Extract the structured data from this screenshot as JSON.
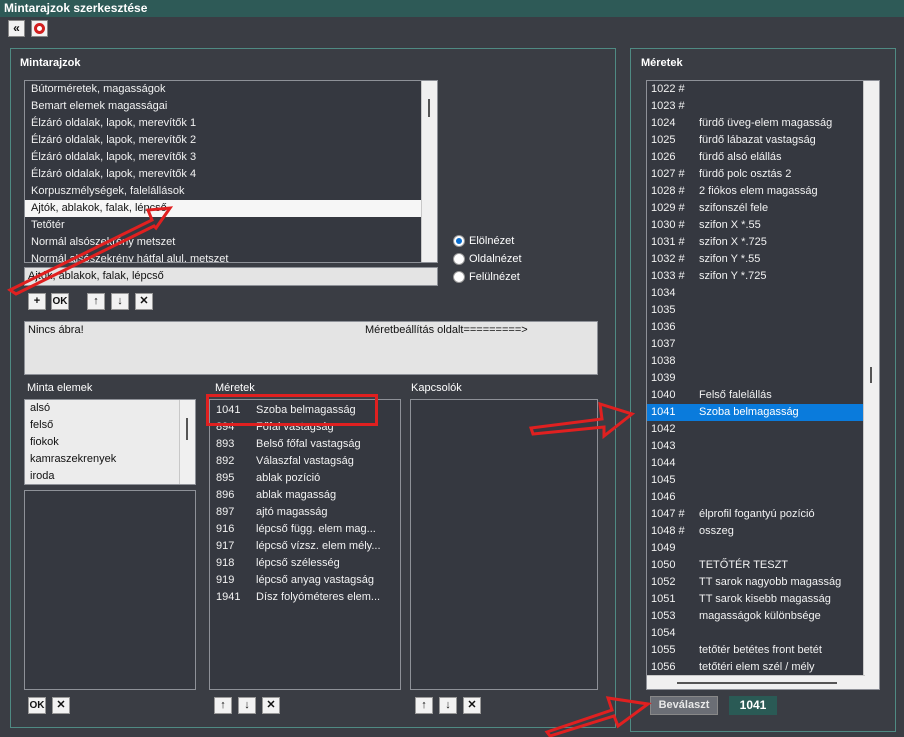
{
  "window": {
    "title": "Mintarajzok szerkesztése"
  },
  "toolbar": {
    "back_icon": "«"
  },
  "patterns": {
    "title": "Mintarajzok",
    "items": [
      "Bútorméretek, magasságok",
      "Bemart elemek magasságai",
      "Élzáró oldalak, lapok, merevítők 1",
      "Élzáró oldalak, lapok, merevítők 2",
      "Élzáró oldalak, lapok, merevítők 3",
      "Élzáró oldalak, lapok, merevítők 4",
      "Korpuszmélységek, falelállások",
      "Ajtók, ablakok, falak, lépcső",
      "Tetőtér",
      "Normál alsószekrény metszet",
      "Normál alsószekrény hátfal alul, metszet"
    ],
    "selected_index": 7,
    "name_value": "Ajtók, ablakok, falak, lépcső",
    "ok_label": "OK",
    "add_icon": "+",
    "up_icon": "↑",
    "down_icon": "↓",
    "delete_icon": "✕"
  },
  "views": {
    "options": [
      "Elölnézet",
      "Oldalnézet",
      "Felülnézet"
    ],
    "selected": "Elölnézet"
  },
  "preview": {
    "no_image": "Nincs ábra!",
    "hint": "Méretbeállítás oldalt=========>"
  },
  "elements": {
    "title": "Minta elemek",
    "items": [
      "alsó",
      "felső",
      "fiokok",
      "kamraszekrenyek",
      "iroda"
    ],
    "ok_label": "OK",
    "delete_icon": "✕"
  },
  "sizes_mid": {
    "title": "Méretek",
    "items": [
      {
        "code": "1041",
        "name": "Szoba belmagasság"
      },
      {
        "code": "894",
        "name": "Főfal vastagság"
      },
      {
        "code": "893",
        "name": "Belső főfal vastagság"
      },
      {
        "code": "892",
        "name": "Válaszfal vastagság"
      },
      {
        "code": "895",
        "name": "ablak pozíció"
      },
      {
        "code": "896",
        "name": "ablak magasság"
      },
      {
        "code": "897",
        "name": "ajtó magasság"
      },
      {
        "code": "916",
        "name": "lépcső függ. elem mag..."
      },
      {
        "code": "917",
        "name": "lépcső vízsz. elem mély..."
      },
      {
        "code": "918",
        "name": "lépcső szélesség"
      },
      {
        "code": "919",
        "name": "lépcső anyag vastagság"
      },
      {
        "code": "1941",
        "name": "Dísz folyóméteres elem..."
      }
    ],
    "up_icon": "↑",
    "down_icon": "↓",
    "delete_icon": "✕"
  },
  "switches": {
    "title": "Kapcsolók",
    "up_icon": "↑",
    "down_icon": "↓",
    "delete_icon": "✕"
  },
  "sizes_right": {
    "title": "Méretek",
    "items": [
      {
        "code": "1022 #",
        "name": ""
      },
      {
        "code": "1023 #",
        "name": ""
      },
      {
        "code": "1024",
        "name": "fürdő üveg-elem magasság"
      },
      {
        "code": "1025",
        "name": "fürdő lábazat vastagság"
      },
      {
        "code": "1026",
        "name": "fürdő alsó elállás"
      },
      {
        "code": "1027 #",
        "name": "fürdő polc osztás 2"
      },
      {
        "code": "1028 #",
        "name": "2 fiókos elem magasság"
      },
      {
        "code": "1029 #",
        "name": "szifonszél fele"
      },
      {
        "code": "1030 #",
        "name": "szifon X *.55"
      },
      {
        "code": "1031 #",
        "name": "szifon X *.725"
      },
      {
        "code": "1032 #",
        "name": "szifon Y *.55"
      },
      {
        "code": "1033 #",
        "name": "szifon Y *.725"
      },
      {
        "code": "1034",
        "name": ""
      },
      {
        "code": "1035",
        "name": ""
      },
      {
        "code": "1036",
        "name": ""
      },
      {
        "code": "1037",
        "name": ""
      },
      {
        "code": "1038",
        "name": ""
      },
      {
        "code": "1039",
        "name": ""
      },
      {
        "code": "1040",
        "name": "Felső falelállás"
      },
      {
        "code": "1041",
        "name": "Szoba belmagasság"
      },
      {
        "code": "1042",
        "name": ""
      },
      {
        "code": "1043",
        "name": ""
      },
      {
        "code": "1044",
        "name": ""
      },
      {
        "code": "1045",
        "name": ""
      },
      {
        "code": "1046",
        "name": ""
      },
      {
        "code": "1047 #",
        "name": "élprofil fogantyú pozíció"
      },
      {
        "code": "1048 #",
        "name": "osszeg"
      },
      {
        "code": "1049",
        "name": ""
      },
      {
        "code": "1050",
        "name": "TETŐTÉR TESZT"
      },
      {
        "code": "1052",
        "name": "TT sarok nagyobb magasság"
      },
      {
        "code": "1051",
        "name": "TT sarok kisebb magasság"
      },
      {
        "code": "1053",
        "name": "magasságok különbsége"
      },
      {
        "code": "1054",
        "name": ""
      },
      {
        "code": "1055",
        "name": "tetőtér betétes front betét"
      },
      {
        "code": "1056",
        "name": "tetőtéri elem szél / mély"
      }
    ],
    "selected_index": 19,
    "select_label": "Beválaszt",
    "selected_value": "1041"
  },
  "colors": {
    "accent": "#0a7bdc",
    "highlight": "#e02020",
    "frame": "#4f8a83"
  }
}
